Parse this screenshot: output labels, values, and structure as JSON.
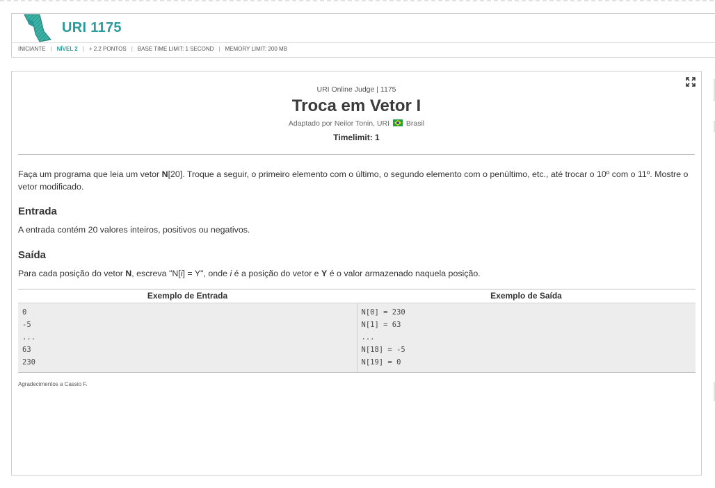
{
  "header": {
    "problem_code": "URI 1175",
    "meta": {
      "category": "INICIANTE",
      "level": "NÍVEL 2",
      "points": "+ 2.2 PONTOS",
      "time_limit": "BASE TIME LIMIT: 1 SECOND",
      "memory_limit": "MEMORY LIMIT: 200 MB"
    }
  },
  "problem": {
    "judge_line": "URI Online Judge | 1175",
    "title": "Troca em Vetor I",
    "author_prefix": "Adaptado por Neilor Tonin, URI",
    "author_country": "Brasil",
    "timelimit": "Timelimit: 1",
    "description": {
      "part1": "Faça um programa que leia um vetor ",
      "bold_n": "N",
      "part2": "[20]. Troque a seguir, o primeiro elemento com o último, o segundo elemento com o penúltimo, etc., até trocar o 10º com o 11º. Mostre o vetor modificado."
    },
    "input_heading": "Entrada",
    "input_text": "A entrada contém 20 valores inteiros, positivos ou negativos.",
    "output_heading": "Saída",
    "output_text": {
      "p1": "Para cada posição do vetor ",
      "b1": "N",
      "p2": ", escreva \"N[",
      "i1": "i",
      "p3": "] = Y\", onde ",
      "i2": "i",
      "p4": " é a posição do vetor e ",
      "b2": "Y",
      "p5": " é o valor armazenado naquela posição."
    },
    "examples": {
      "input_header": "Exemplo de Entrada",
      "output_header": "Exemplo de Saída",
      "input_lines": [
        "0",
        "-5",
        "...",
        "63",
        "230"
      ],
      "output_lines": [
        "N[0] = 230",
        "N[1] = 63",
        "...",
        "N[18] = -5",
        "N[19] = 0"
      ]
    },
    "thanks": "Agradecimentos a Cassio F."
  },
  "colors": {
    "accent": "#2a9a9a",
    "example_bg": "#ededed"
  },
  "icons": {
    "logo": "numeral-one-logo",
    "expand": "expand-icon",
    "flag": "brazil-flag-icon"
  }
}
